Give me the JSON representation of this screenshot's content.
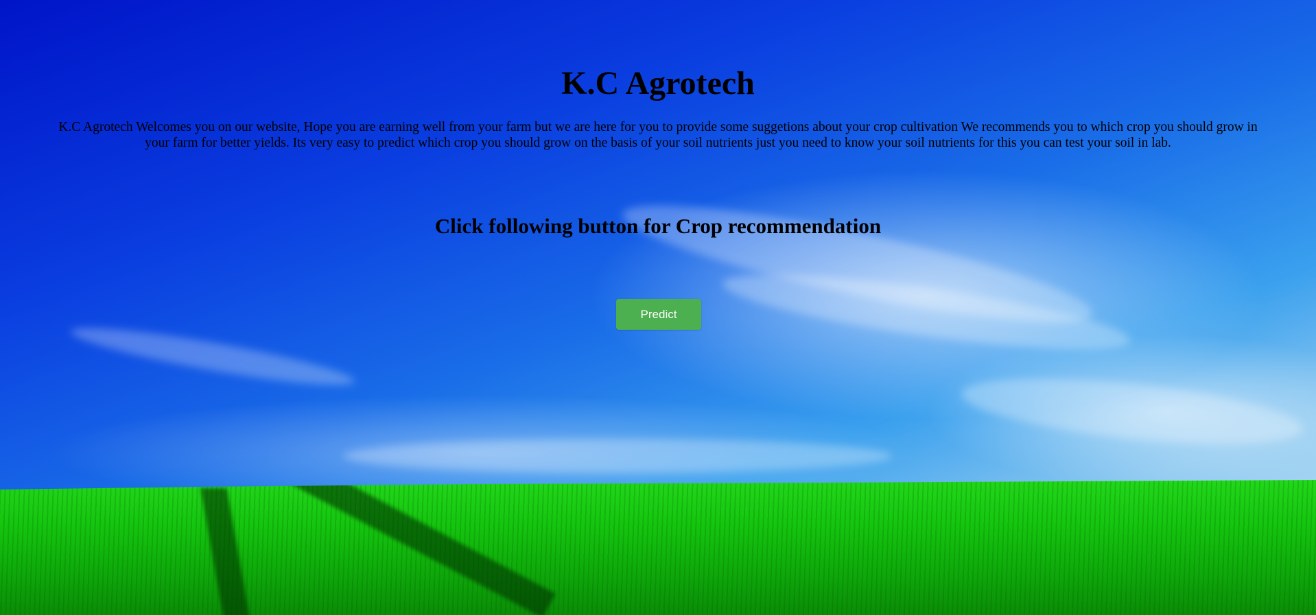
{
  "page": {
    "title": "K.C Agrotech",
    "intro": "K.C Agrotech Welcomes you on our website, Hope you are earning well from your farm but we are here for you to provide some suggetions about your crop cultivation We recommends you to which crop you should grow in your farm for better yields. Its very easy to predict which crop you should grow on the basis of your soil nutrients just you need to know your soil nutrients for this you can test your soil in lab.",
    "subtitle": "Click following button for Crop recommendation",
    "predict_label": "Predict"
  },
  "colors": {
    "button": "#4caf50",
    "button_text": "#ffffff",
    "sky_top": "#0014c8",
    "grass": "#14c40e"
  }
}
